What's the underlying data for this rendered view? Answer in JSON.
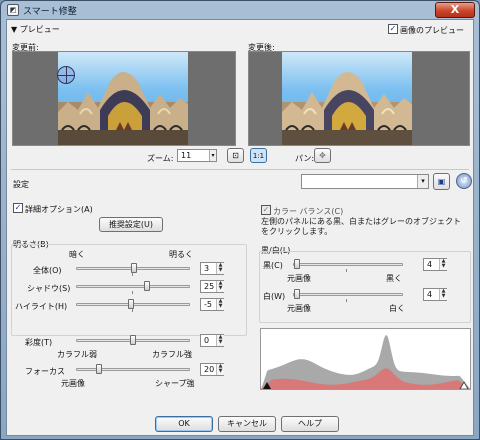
{
  "window": {
    "title": "スマート修整",
    "close_label": "X"
  },
  "preview": {
    "section_label": "▼ プレビュー",
    "show_preview_checkbox": "画像のプレビュー",
    "before_label": "変更前:",
    "after_label": "変更後:",
    "zoom_label": "ズーム:",
    "zoom_value": "11",
    "pan_label": "パン:"
  },
  "settings": {
    "label": "設定",
    "value": ""
  },
  "suggest": {
    "checkbox_label": "詳細オプション(A)",
    "button_label": "推奨設定(U)"
  },
  "brightness": {
    "group_label": "明るさ(B)",
    "dark_label": "暗く",
    "bright_label": "明るく",
    "rows": [
      {
        "label": "全体(O)",
        "value": "3",
        "level": 0.51
      },
      {
        "label": "シャドウ(S)",
        "value": "25",
        "level": 0.62
      },
      {
        "label": "ハイライト(H)",
        "value": "-5",
        "level": 0.48
      }
    ]
  },
  "saturation": {
    "label": "彩度(T)",
    "value": "0",
    "level": 0.5,
    "low_label": "カラフル弱",
    "high_label": "カラフル強"
  },
  "focus": {
    "label": "フォーカス",
    "value": "20",
    "level": 0.2,
    "low_label": "元画像",
    "high_label": "シャープ強"
  },
  "color_balance": {
    "checkbox_label": "カラー バランス(C)",
    "description": "左側のパネルにある黒、白またはグレーのオブジェクトをクリックします。"
  },
  "black_white": {
    "group_label": "黒/白(L)",
    "black": {
      "label": "黒(C)",
      "value": "4",
      "level": 0.04,
      "low_label": "元画像",
      "high_label": "黒く"
    },
    "white": {
      "label": "白(W)",
      "value": "4",
      "level": 0.04,
      "low_label": "元画像",
      "high_label": "白く"
    }
  },
  "footer": {
    "ok": "OK",
    "cancel": "キャンセル",
    "help": "ヘルプ"
  },
  "colors": {
    "accent": "#1b3b8a",
    "histogram_gray": "#a9a9a9",
    "histogram_red": "#e27070"
  }
}
